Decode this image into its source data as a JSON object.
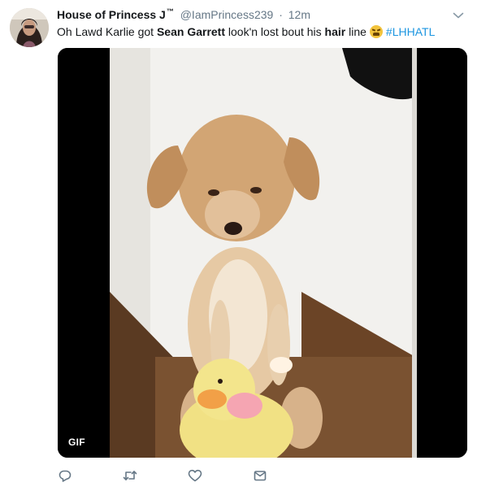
{
  "tweet": {
    "author_name": "House of Princess J",
    "author_name_suffix": "™",
    "handle": "@IamPrincess239",
    "separator": "·",
    "timestamp": "12m",
    "text": {
      "part1": "Oh Lawd Karlie got ",
      "bold1": "Sean Garrett",
      "part2": " look'n lost bout his ",
      "bold2": "hair",
      "part3": " line",
      "emoji": "weary-face-emoji",
      "hashtag": "#LHHATL"
    },
    "media": {
      "badge": "GIF",
      "content": "puppy-with-toy-duck"
    }
  },
  "icons": {
    "caret": "chevron-down-icon",
    "reply": "reply-icon",
    "retweet": "retweet-icon",
    "like": "heart-icon",
    "message": "envelope-icon"
  },
  "colors": {
    "link": "#1b95e0",
    "secondary_text": "#657786",
    "icon": "#657786"
  }
}
